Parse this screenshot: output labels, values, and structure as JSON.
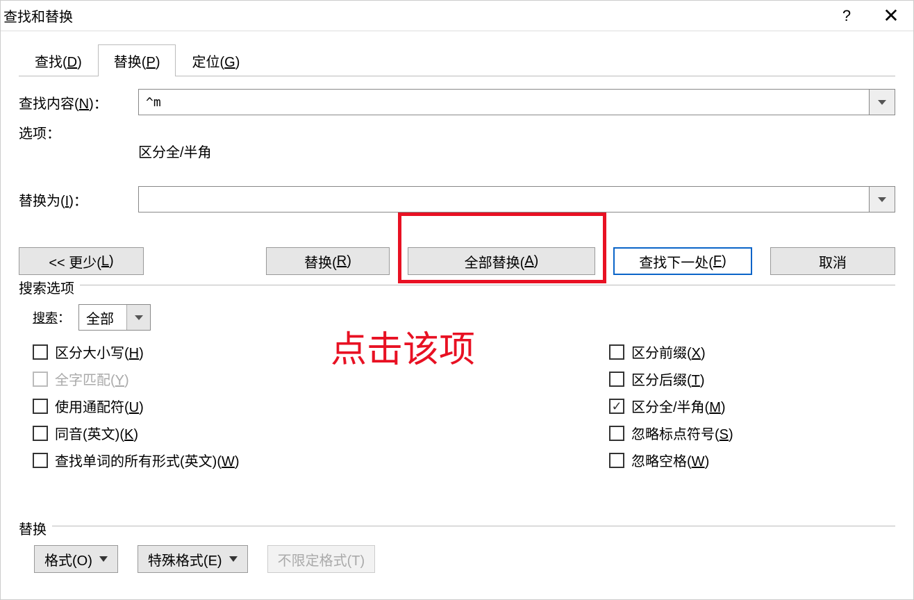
{
  "titlebar": {
    "title": "查找和替换"
  },
  "tabs": {
    "find": {
      "label": "查找(",
      "key": "D",
      "suffix": ")"
    },
    "replace": {
      "label": "替换(",
      "key": "P",
      "suffix": ")"
    },
    "goto": {
      "label": "定位(",
      "key": "G",
      "suffix": ")"
    }
  },
  "find": {
    "label_pre": "查找内容(",
    "label_key": "N",
    "label_post": ")：",
    "value": "^m"
  },
  "options_line": {
    "label": "选项：",
    "value": "区分全/半角"
  },
  "replace_with": {
    "label_pre": "替换为(",
    "label_key": "I",
    "label_post": ")：",
    "value": ""
  },
  "buttons": {
    "less": {
      "pre": "<< 更少(",
      "key": "L",
      "post": ")"
    },
    "replace": {
      "pre": "替换(",
      "key": "R",
      "post": ")"
    },
    "replace_all": {
      "pre": "全部替换(",
      "key": "A",
      "post": ")"
    },
    "find_next": {
      "pre": "查找下一处(",
      "key": "F",
      "post": ")"
    },
    "cancel": {
      "label": "取消"
    }
  },
  "annotation": "点击该项",
  "search_options": {
    "legend": "搜索选项",
    "search_label_pre": "搜索",
    "search_label_post": "：",
    "search_value": "全部",
    "left": [
      {
        "pre": "区分大小写(",
        "key": "H",
        "post": ")",
        "checked": false,
        "disabled": false
      },
      {
        "pre": "全字匹配(",
        "key": "Y",
        "post": ")",
        "checked": false,
        "disabled": true
      },
      {
        "pre": "使用通配符(",
        "key": "U",
        "post": ")",
        "checked": false,
        "disabled": false
      },
      {
        "pre": "同音(英文)(",
        "key": "K",
        "post": ")",
        "checked": false,
        "disabled": false
      },
      {
        "pre": "查找单词的所有形式(英文)(",
        "key": "W",
        "post": ")",
        "checked": false,
        "disabled": false
      }
    ],
    "right": [
      {
        "pre": "区分前缀(",
        "key": "X",
        "post": ")",
        "checked": false
      },
      {
        "pre": "区分后缀(",
        "key": "T",
        "post": ")",
        "checked": false
      },
      {
        "pre": "区分全/半角(",
        "key": "M",
        "post": ")",
        "checked": true
      },
      {
        "pre": "忽略标点符号(",
        "key": "S",
        "post": ")",
        "checked": false
      },
      {
        "pre": "忽略空格(",
        "key": "W",
        "post": ")",
        "checked": false
      }
    ]
  },
  "replace_section": {
    "legend": "替换",
    "format": {
      "pre": "格式(",
      "key": "O",
      "post": ")"
    },
    "special": {
      "pre": "特殊格式(",
      "key": "E",
      "post": ")"
    },
    "no_format": {
      "pre": "不限定格式(",
      "key": "T",
      "post": ")"
    }
  }
}
